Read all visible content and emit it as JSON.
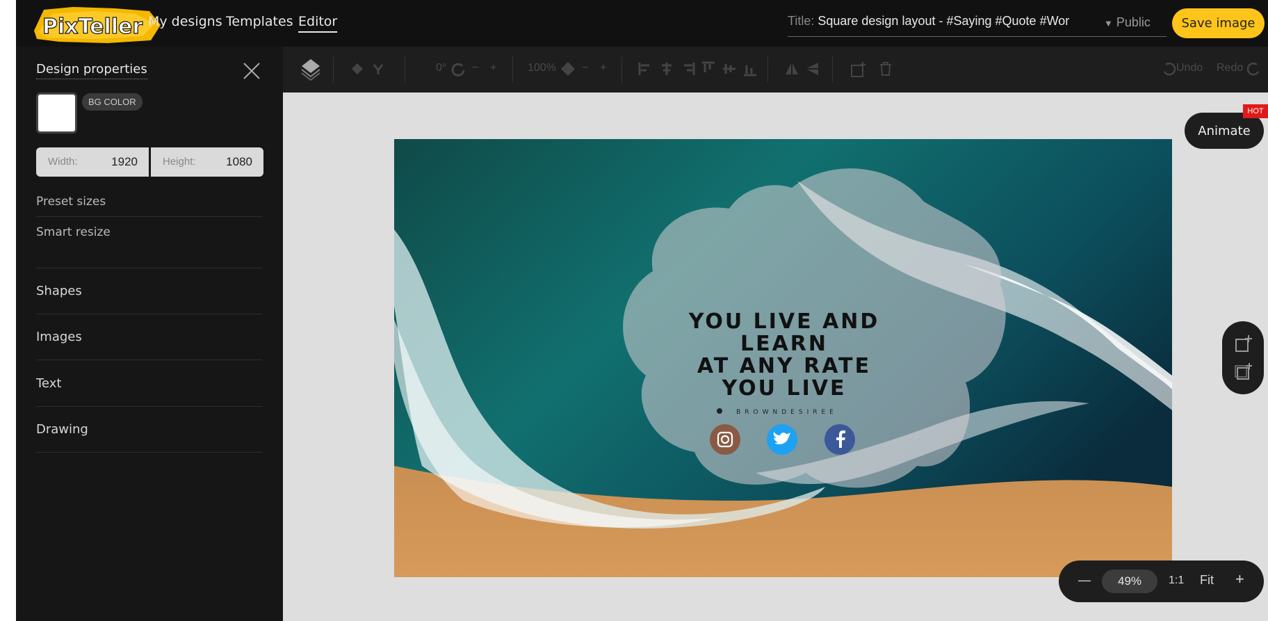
{
  "header": {
    "logo_text": "PixTeller",
    "nav": [
      "My designs",
      "Templates",
      "Editor"
    ],
    "title_label": "Title:",
    "title_value": "Square design layout - #Saying #Quote #Wor",
    "visibility": "Public",
    "save_label": "Save image"
  },
  "sidebar": {
    "title": "Design properties",
    "bg_color_label": "BG COLOR",
    "bg_color_value": "#ffffff",
    "width_label": "Width:",
    "width_value": "1920",
    "height_label": "Height:",
    "height_value": "1080",
    "links": [
      "Preset sizes",
      "Smart resize"
    ],
    "sections": [
      "Shapes",
      "Images",
      "Text",
      "Drawing"
    ]
  },
  "toolbar": {
    "zoom_level": "100%",
    "rotation": "0°",
    "undo_label": "Undo",
    "redo_label": "Redo"
  },
  "design": {
    "quote_lines": [
      "YOU LIVE AND",
      "LEARN",
      "AT ANY RATE",
      "YOU LIVE"
    ],
    "handle": "BROWNDESIREE",
    "social_icons": [
      "instagram-icon",
      "twitter-icon",
      "facebook-icon"
    ]
  },
  "animate": {
    "label": "Animate",
    "badge": "HOT"
  },
  "zoom": {
    "minus": "—",
    "value": "49%",
    "one_to_one": "1:1",
    "fit": "Fit",
    "plus": "+"
  },
  "colors": {
    "accent": "#ffc41a",
    "dark": "#111111",
    "hot": "#e01a1a",
    "twitter": "#1da1f2",
    "facebook": "#3b5998",
    "instagram": "#8a5a44"
  }
}
